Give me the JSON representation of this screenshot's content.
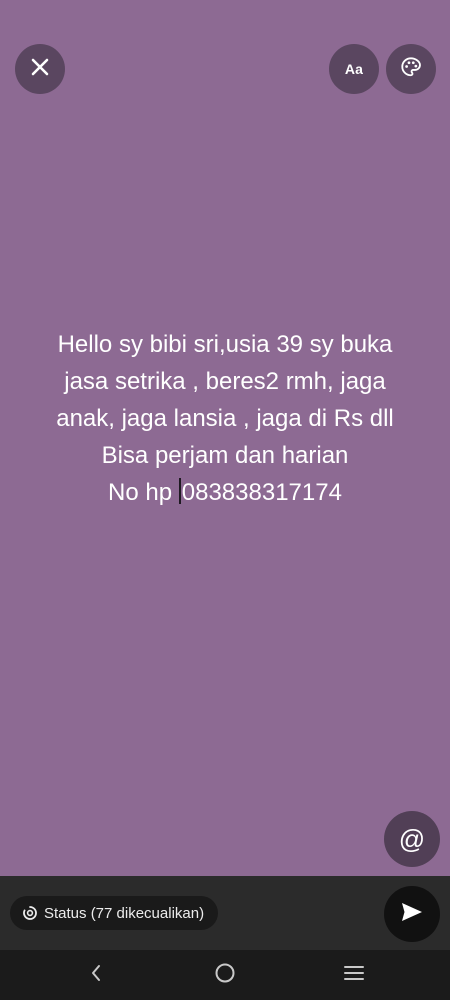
{
  "toolbar": {
    "close_icon": "close-icon",
    "font_label": "Aa",
    "palette_icon": "palette-icon"
  },
  "status": {
    "text": "Hello sy bibi sri,usia 39 sy buka\njasa setrika , beres2 rmh, jaga\nanak, jaga lansia , jaga di Rs dll\nBisa perjam dan harian\nNo hp ",
    "phone": "083838317174",
    "background": "#8d6a93"
  },
  "mention": {
    "symbol": "@"
  },
  "footer": {
    "audience_label": "Status (77 dikecualikan)",
    "send_icon": "send-icon"
  },
  "navigation": {
    "back_icon": "back-icon",
    "home_icon": "home-icon",
    "menu_icon": "menu-icon"
  }
}
